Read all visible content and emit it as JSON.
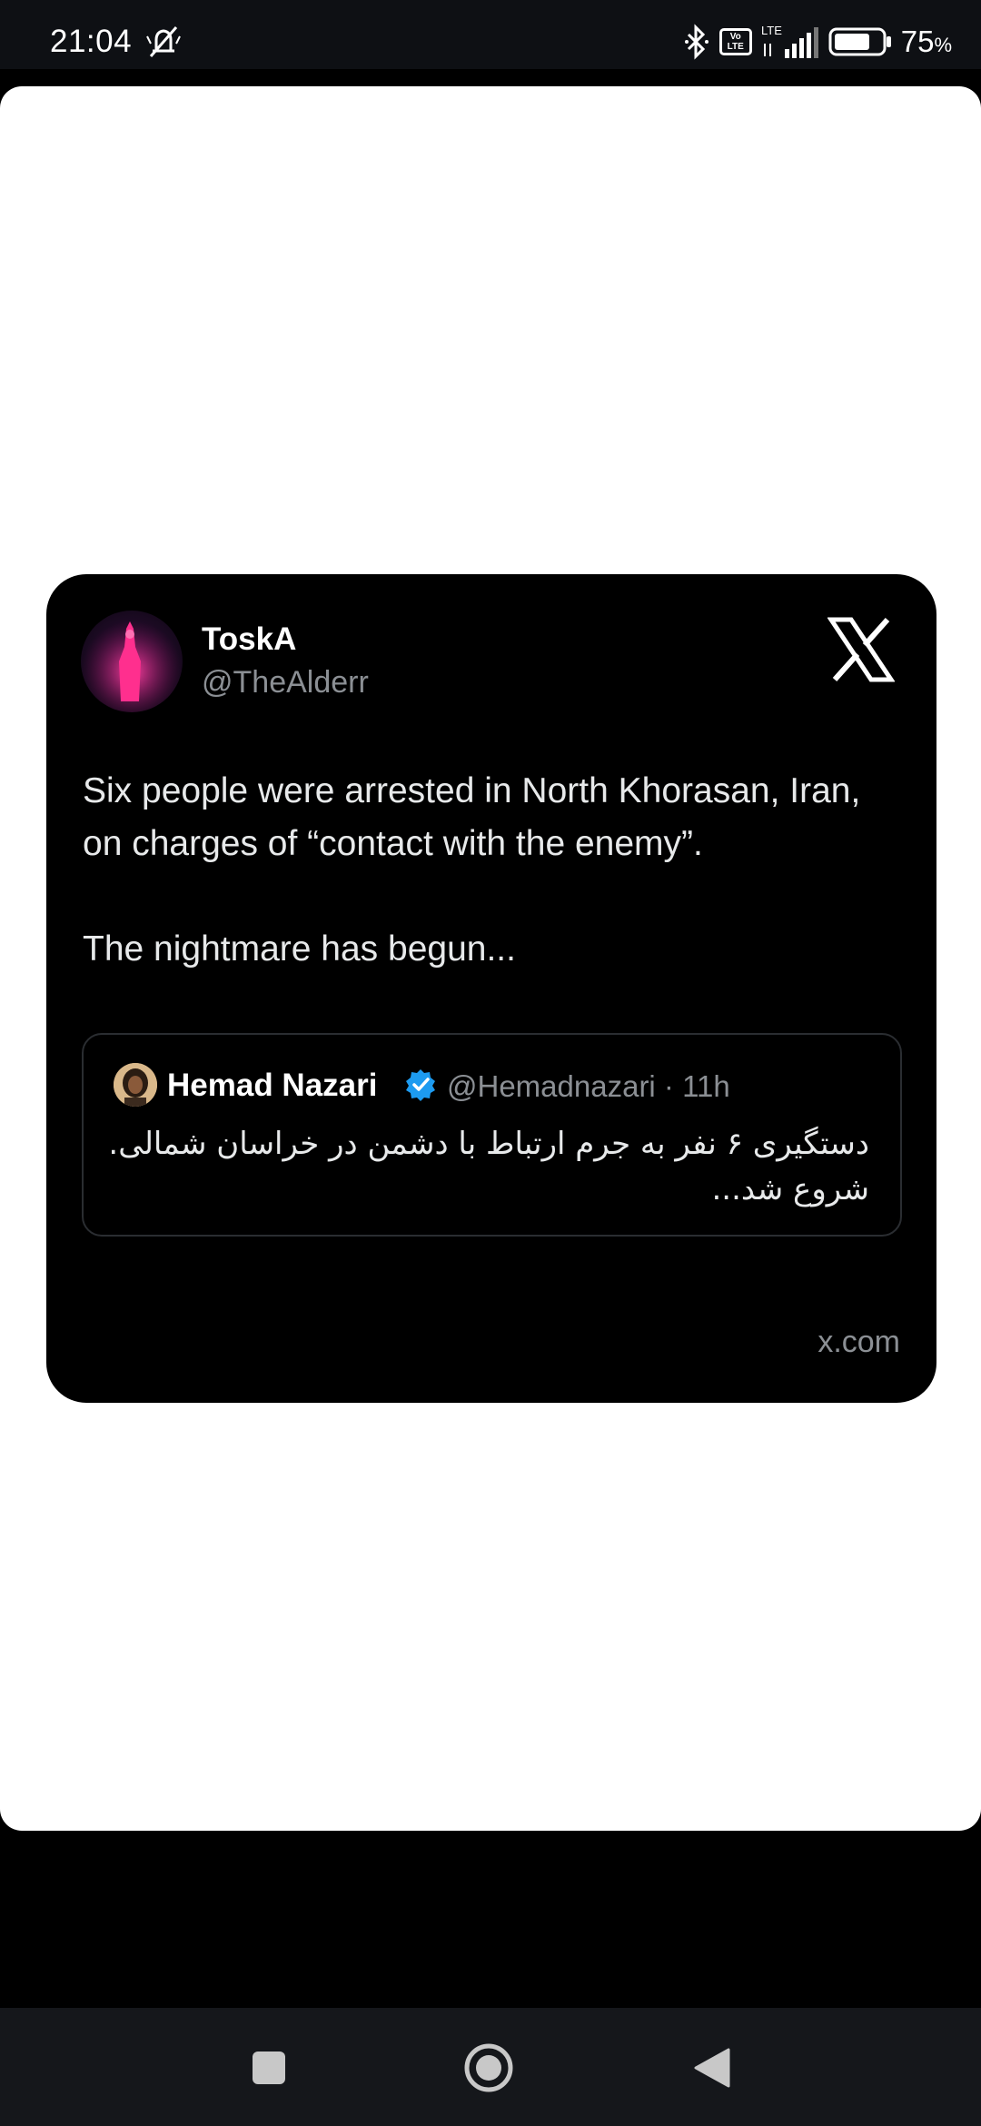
{
  "status_bar": {
    "time": "21:04",
    "battery_level": "75",
    "battery_unit": "%",
    "network": "LTE",
    "volte_label": "Vo LTE",
    "icons": [
      "mute-icon",
      "bluetooth-icon",
      "volte-icon",
      "signal-icon",
      "battery-icon"
    ]
  },
  "tweet": {
    "author_name": "ToskA",
    "author_handle": "@TheAlderr",
    "text": "Six people were arrested in North Khorasan, Iran,  on charges of “contact with the enemy”.\n\nThe nightmare has begun...",
    "source": "x.com",
    "quote": {
      "author_name": "Hemad Nazari",
      "meta": "@Hemadnazari · 11h",
      "text": "دستگیری ۶ نفر به جرم ارتباط با دشمن در خراسان شمالی. شروع شد..."
    }
  },
  "nav": {
    "buttons": [
      "recent-apps",
      "home",
      "back"
    ]
  },
  "colors": {
    "card_bg": "#000000",
    "sheet_bg": "#ffffff",
    "muted_text": "#8b8f94",
    "verified_blue": "#1d9bf0"
  }
}
